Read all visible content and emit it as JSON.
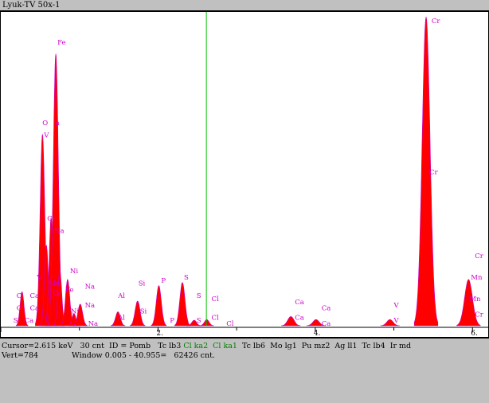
{
  "window": {
    "title": "Lyuk-TV 50x-1"
  },
  "chart_data": {
    "type": "area",
    "xlabel": "",
    "ylabel": "",
    "xlim": [
      0.0,
      6.2
    ],
    "x_ticks": [
      "2.",
      "4.",
      "6."
    ],
    "colors": {
      "fill": "#ff0000",
      "line": "#cc00cc",
      "marker": "#00c000"
    },
    "cursor_kev": 2.615,
    "peaks": [
      {
        "x": 0.27,
        "h": 0.11,
        "w": 0.025
      },
      {
        "x": 0.53,
        "h": 0.62,
        "w": 0.03
      },
      {
        "x": 0.58,
        "h": 0.26,
        "w": 0.025
      },
      {
        "x": 0.64,
        "h": 0.35,
        "w": 0.025
      },
      {
        "x": 0.7,
        "h": 0.88,
        "w": 0.032
      },
      {
        "x": 0.75,
        "h": 0.18,
        "w": 0.025
      },
      {
        "x": 0.85,
        "h": 0.15,
        "w": 0.028
      },
      {
        "x": 0.93,
        "h": 0.04,
        "w": 0.025
      },
      {
        "x": 1.01,
        "h": 0.07,
        "w": 0.03
      },
      {
        "x": 1.49,
        "h": 0.045,
        "w": 0.03
      },
      {
        "x": 1.74,
        "h": 0.08,
        "w": 0.032
      },
      {
        "x": 2.01,
        "h": 0.13,
        "w": 0.032
      },
      {
        "x": 2.31,
        "h": 0.14,
        "w": 0.033
      },
      {
        "x": 2.46,
        "h": 0.018,
        "w": 0.03
      },
      {
        "x": 2.62,
        "h": 0.02,
        "w": 0.03
      },
      {
        "x": 3.69,
        "h": 0.03,
        "w": 0.04
      },
      {
        "x": 4.01,
        "h": 0.02,
        "w": 0.04
      },
      {
        "x": 4.95,
        "h": 0.02,
        "w": 0.04
      },
      {
        "x": 5.41,
        "h": 1.0,
        "w": 0.05
      },
      {
        "x": 5.95,
        "h": 0.15,
        "w": 0.05
      }
    ],
    "element_labels": [
      {
        "text": "Fe",
        "x": 0.72,
        "y": 0.92
      },
      {
        "text": "O",
        "x": 0.53,
        "y": 0.66
      },
      {
        "text": "V",
        "x": 0.55,
        "y": 0.62
      },
      {
        "text": "n",
        "x": 0.69,
        "y": 0.66
      },
      {
        "text": "Cr",
        "x": 0.59,
        "y": 0.35
      },
      {
        "text": "Na",
        "x": 0.68,
        "y": 0.31
      },
      {
        "text": "Ni",
        "x": 0.88,
        "y": 0.18
      },
      {
        "text": "Na",
        "x": 1.07,
        "y": 0.13
      },
      {
        "text": "Na",
        "x": 1.07,
        "y": 0.07
      },
      {
        "text": "Fe",
        "x": 0.82,
        "y": 0.12
      },
      {
        "text": "Ni",
        "x": 0.89,
        "y": 0.05
      },
      {
        "text": "Na",
        "x": 1.11,
        "y": 0.01
      },
      {
        "text": "V",
        "x": 0.46,
        "y": 0.16
      },
      {
        "text": "Mn",
        "x": 0.61,
        "y": 0.14
      },
      {
        "text": "Cr",
        "x": 0.66,
        "y": 0.11
      },
      {
        "text": "C",
        "x": 0.2,
        "y": 0.1
      },
      {
        "text": "Ca",
        "x": 0.37,
        "y": 0.1
      },
      {
        "text": "C",
        "x": 0.2,
        "y": 0.06
      },
      {
        "text": "Ca",
        "x": 0.37,
        "y": 0.06
      },
      {
        "text": "S",
        "x": 0.16,
        "y": 0.02
      },
      {
        "text": "Ca",
        "x": 0.3,
        "y": 0.02
      },
      {
        "text": "Al",
        "x": 1.49,
        "y": 0.1
      },
      {
        "text": "Al",
        "x": 1.49,
        "y": 0.03
      },
      {
        "text": "Si",
        "x": 1.75,
        "y": 0.14
      },
      {
        "text": "Si",
        "x": 1.77,
        "y": 0.05
      },
      {
        "text": "P",
        "x": 2.04,
        "y": 0.15
      },
      {
        "text": "P",
        "x": 2.15,
        "y": 0.02
      },
      {
        "text": "S",
        "x": 2.33,
        "y": 0.16
      },
      {
        "text": "S",
        "x": 2.49,
        "y": 0.1
      },
      {
        "text": "S",
        "x": 2.49,
        "y": 0.02
      },
      {
        "text": "Cl",
        "x": 2.68,
        "y": 0.09
      },
      {
        "text": "Cl",
        "x": 2.68,
        "y": 0.03
      },
      {
        "text": "Cl",
        "x": 2.87,
        "y": 0.01
      },
      {
        "text": "Ca",
        "x": 3.74,
        "y": 0.08
      },
      {
        "text": "Ca",
        "x": 3.74,
        "y": 0.03
      },
      {
        "text": "Ca",
        "x": 4.08,
        "y": 0.06
      },
      {
        "text": "Ca",
        "x": 4.08,
        "y": 0.01
      },
      {
        "text": "V",
        "x": 5.0,
        "y": 0.07
      },
      {
        "text": "V",
        "x": 5.0,
        "y": 0.02
      },
      {
        "text": "Cr",
        "x": 5.48,
        "y": 0.99
      },
      {
        "text": "Cr",
        "x": 5.45,
        "y": 0.5
      },
      {
        "text": "Cr",
        "x": 6.03,
        "y": 0.23
      },
      {
        "text": "Mn",
        "x": 5.98,
        "y": 0.16
      },
      {
        "text": "Mn",
        "x": 5.96,
        "y": 0.09
      },
      {
        "text": "Cr",
        "x": 6.03,
        "y": 0.04
      }
    ]
  },
  "status": {
    "cursor": "Cursor=2.615 keV   30 cnt  ID = Pomb   Tc lb3",
    "cursor_green": "Cl ka2  Cl ka1",
    "cursor_tail": "  Tc lb6  Mo lg1  Pu mz2  Ag ll1  Tc lb4  Ir md",
    "vert": "Vert=784",
    "window": "Window 0.005 - 40.955=   62426 cnt."
  }
}
